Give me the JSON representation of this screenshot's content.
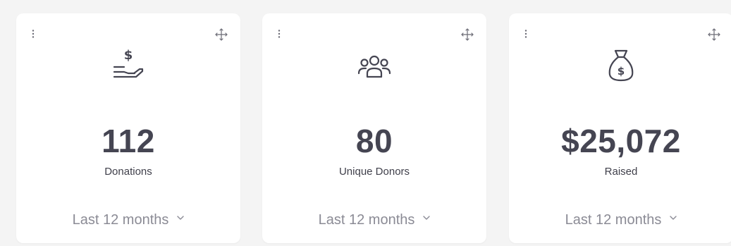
{
  "cards": [
    {
      "icon": "hand-dollar-icon",
      "value": "112",
      "label": "Donations",
      "period": "Last 12 months"
    },
    {
      "icon": "people-group-icon",
      "value": "80",
      "label": "Unique Donors",
      "period": "Last 12 months"
    },
    {
      "icon": "money-bag-icon",
      "value": "$25,072",
      "label": "Raised",
      "period": "Last 12 months"
    }
  ],
  "colors": {
    "background": "#f4f4f4",
    "card": "#ffffff",
    "value_text": "#454552",
    "period_text": "#8b8b95",
    "icon": "#454552"
  }
}
